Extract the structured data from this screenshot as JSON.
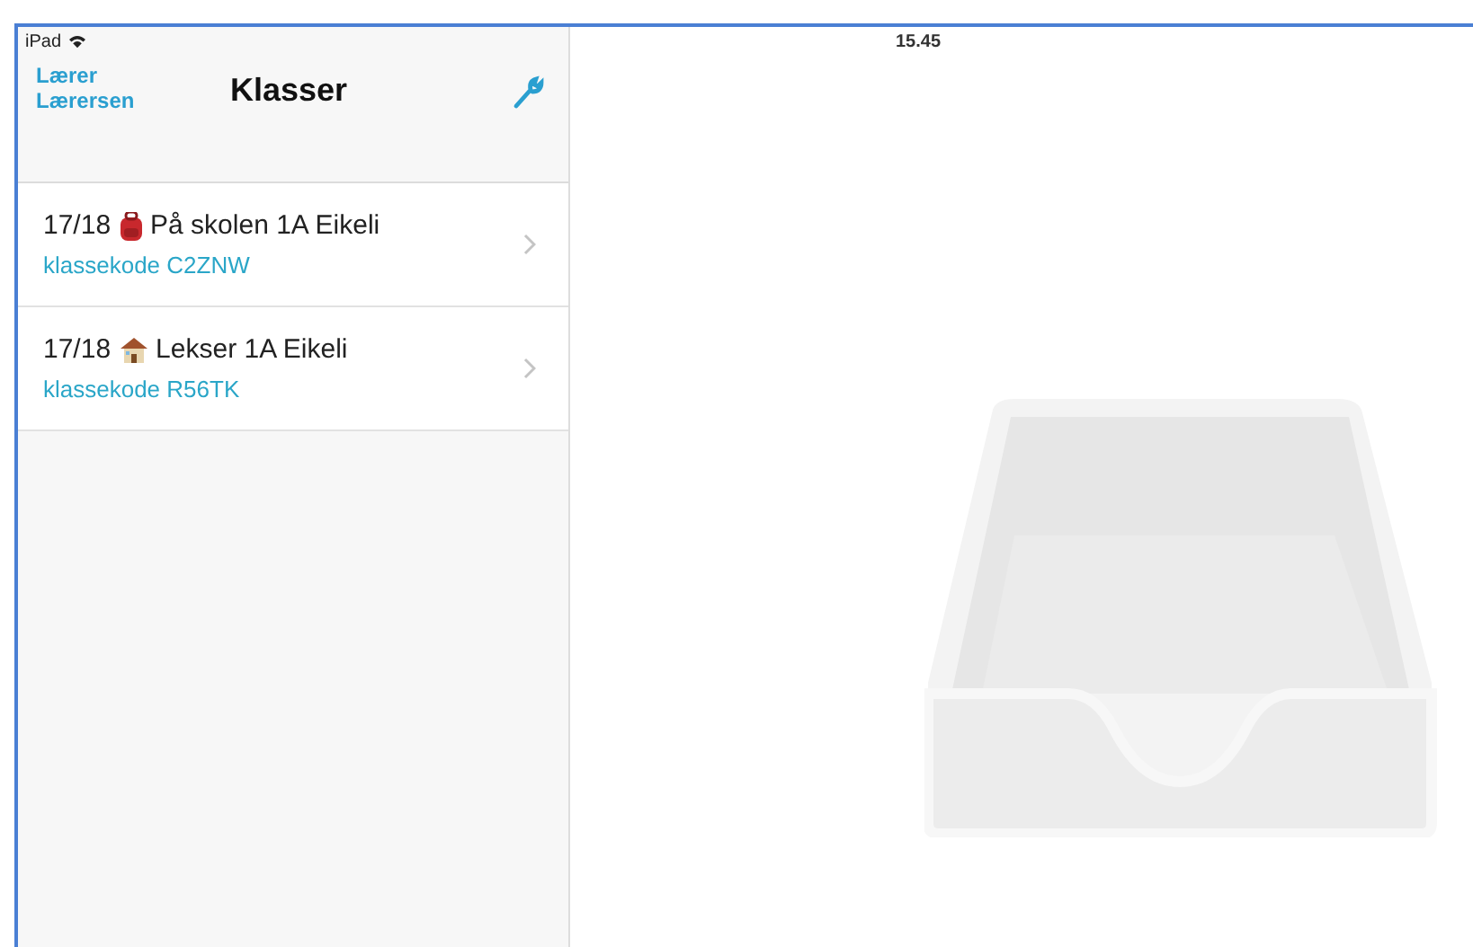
{
  "status_bar": {
    "device": "iPad",
    "time": "15.45"
  },
  "nav": {
    "back": "Lærer Lærersen",
    "title": "Klasser"
  },
  "classes": [
    {
      "year": "17/18",
      "kind": "backpack",
      "name": "På skolen 1A Eikeli",
      "code": "klassekode C2ZNW"
    },
    {
      "year": "17/18",
      "kind": "house",
      "name": "Lekser 1A Eikeli",
      "code": "klassekode R56TK"
    }
  ]
}
